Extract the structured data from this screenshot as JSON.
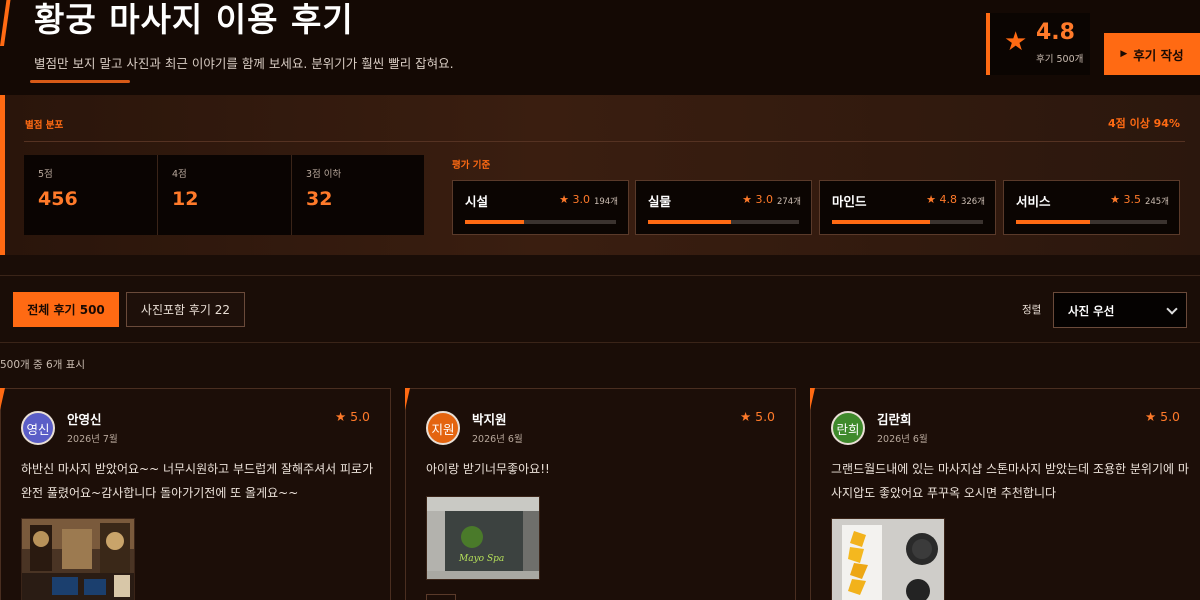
{
  "header": {
    "title": "황궁 마사지 이용 후기",
    "subtitle": "별점만 보지 말고 사진과 최근 이야기를 함께 보세요. 분위기가 훨씬 빨리 잡혀요.",
    "rating": {
      "star": "★",
      "score": "4.8",
      "count_label": "후기 500개"
    },
    "write_button": {
      "icon": "▶",
      "label": "후기 작성"
    }
  },
  "stats": {
    "label": "별점 분포",
    "ratio_label": "4점 이상 94%",
    "distribution": [
      {
        "label": "5점",
        "value": "456"
      },
      {
        "label": "4점",
        "value": "12"
      },
      {
        "label": "3점 이하",
        "value": "32"
      }
    ],
    "criteria_label": "평가 기준",
    "criteria": [
      {
        "name": "시설",
        "score": "★ 3.0",
        "count": "194개",
        "fill": 0.39
      },
      {
        "name": "실물",
        "score": "★ 3.0",
        "count": "274개",
        "fill": 0.55
      },
      {
        "name": "마인드",
        "score": "★ 4.8",
        "count": "326개",
        "fill": 0.65
      },
      {
        "name": "서비스",
        "score": "★ 3.5",
        "count": "245개",
        "fill": 0.49
      }
    ]
  },
  "filters": {
    "tab_all": "전체 후기 500",
    "tab_photo": "사진포함 후기 22",
    "sort_label": "정렬",
    "sort_value": "사진 우선"
  },
  "count_line": "500개 중 6개 표시",
  "reviews": [
    {
      "avatar": "영신",
      "avatar_color": "#5b5ec7",
      "author": "안영신",
      "date": "2026년 7월",
      "rating": "★ 5.0",
      "text": "하반신 마사지 받았어요~~ 너무시원하고 부드럽게 잘해주셔서 피로가 완전 풀렸어요~감사합니다 돌아가기전에 또 올게요~~"
    },
    {
      "avatar": "지원",
      "avatar_color": "#e4640f",
      "author": "박지원",
      "date": "2026년 6월",
      "rating": "★ 5.0",
      "text": "아이랑 받기너무좋아요!!"
    },
    {
      "avatar": "란희",
      "avatar_color": "#3f8a2c",
      "author": "김란희",
      "date": "2026년 6월",
      "rating": "★ 5.0",
      "text": "그랜드월드내에 있는 마사지샵 스톤마사지 받았는데 조용한 분위기에 마사지압도 좋았어요 푸꾸옥 오시면 추천합니다"
    }
  ],
  "photo_sign_text": "Mayo Spa"
}
